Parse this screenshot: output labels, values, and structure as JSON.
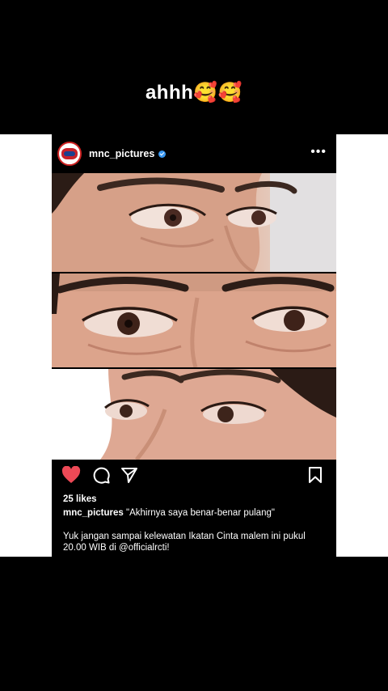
{
  "overlay": {
    "caption_text": "ahhh",
    "caption_emoji": "🥰🥰"
  },
  "post": {
    "username": "mnc_pictures",
    "likes": "25 likes",
    "caption_quote": "\"Akhirnya saya benar-benar pulang\"",
    "caption_body": "Yuk jangan sampai kelewatan Ikatan Cinta malem ini pukul 20.00 WIB di @officialrcti!",
    "icons": [
      "heart-icon",
      "comment-icon",
      "share-icon",
      "bookmark-icon",
      "more-icon",
      "verified-icon"
    ],
    "colors": {
      "heart": "#ed4956",
      "verified": "#3897f0",
      "background": "#000000"
    }
  }
}
